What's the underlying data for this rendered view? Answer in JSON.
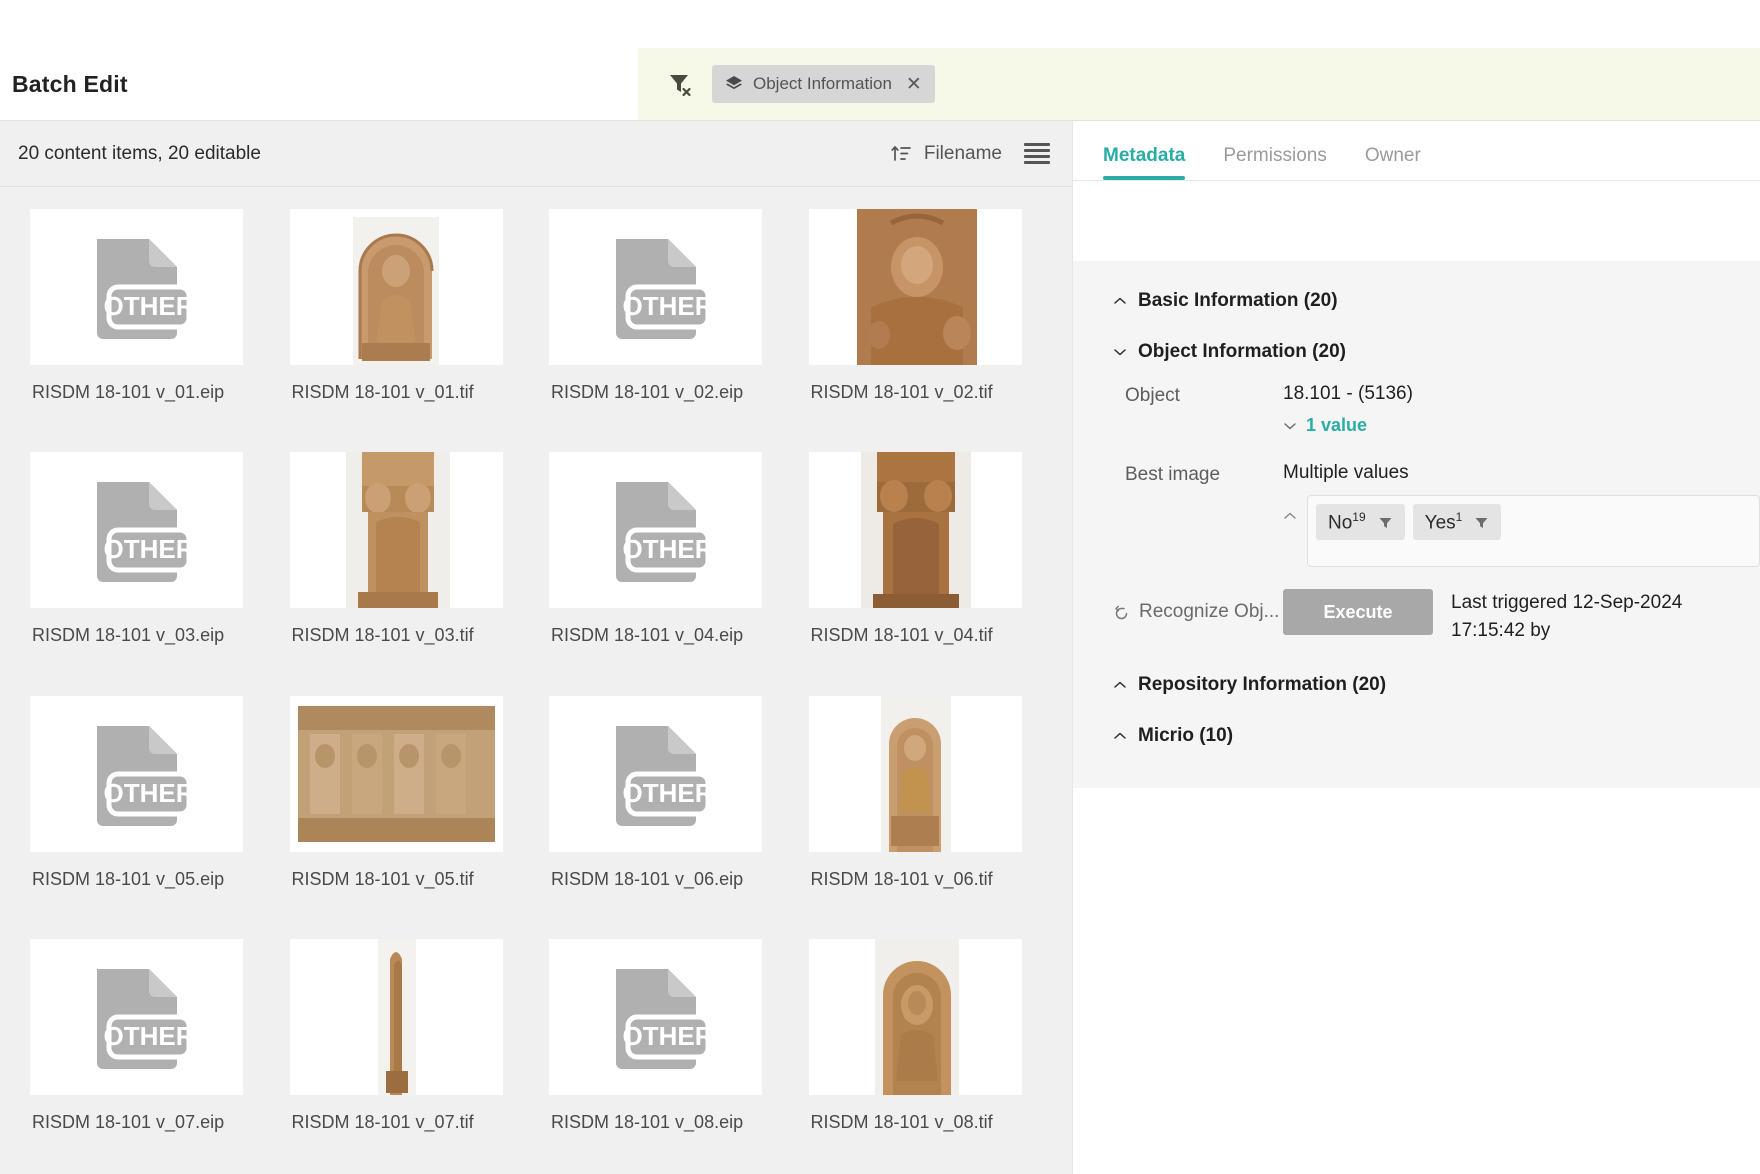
{
  "header": {
    "title": "Batch Edit",
    "filter_clear_icon": "filter-clear-icon",
    "active_filter": {
      "icon": "layers-icon",
      "label": "Object Information",
      "close": "✕"
    }
  },
  "left_pane": {
    "items_count": "20 content items, 20 editable",
    "sort": {
      "icon": "sort-ascending-icon",
      "label": "Filename"
    },
    "view_toggle_icon": "list-view-icon",
    "items": [
      {
        "name": "RISDM 18-101 v_01.eip",
        "type": "other"
      },
      {
        "name": "RISDM 18-101 v_01.tif",
        "type": "photo",
        "variant": "stele-seated"
      },
      {
        "name": "RISDM 18-101 v_02.eip",
        "type": "other"
      },
      {
        "name": "RISDM 18-101 v_02.tif",
        "type": "photo",
        "variant": "relief-close"
      },
      {
        "name": "RISDM 18-101 v_03.eip",
        "type": "other"
      },
      {
        "name": "RISDM 18-101 v_03.tif",
        "type": "photo",
        "variant": "pillar-lions"
      },
      {
        "name": "RISDM 18-101 v_04.eip",
        "type": "other"
      },
      {
        "name": "RISDM 18-101 v_04.tif",
        "type": "photo",
        "variant": "pillar-lions-dark"
      },
      {
        "name": "RISDM 18-101 v_05.eip",
        "type": "other"
      },
      {
        "name": "RISDM 18-101 v_05.tif",
        "type": "photo",
        "variant": "base-frieze"
      },
      {
        "name": "RISDM 18-101 v_06.eip",
        "type": "other"
      },
      {
        "name": "RISDM 18-101 v_06.tif",
        "type": "photo",
        "variant": "stele-tall"
      },
      {
        "name": "RISDM 18-101 v_07.eip",
        "type": "other"
      },
      {
        "name": "RISDM 18-101 v_07.tif",
        "type": "photo",
        "variant": "edge-thin"
      },
      {
        "name": "RISDM 18-101 v_08.eip",
        "type": "other"
      },
      {
        "name": "RISDM 18-101 v_08.tif",
        "type": "photo",
        "variant": "stele-arched"
      }
    ],
    "placeholder_label": "OTHER"
  },
  "right_pane": {
    "tabs": [
      {
        "label": "Metadata",
        "active": true
      },
      {
        "label": "Permissions",
        "active": false
      },
      {
        "label": "Owner",
        "active": false
      }
    ],
    "sections": {
      "basic_information": {
        "title": "Basic Information (20)",
        "state": "collapsed"
      },
      "object_information": {
        "title": "Object Information (20)",
        "state": "expanded"
      },
      "repository_information": {
        "title": "Repository Information (20)",
        "state": "collapsed"
      },
      "micrio": {
        "title": "Micrio (10)",
        "state": "collapsed"
      }
    },
    "fields": {
      "object": {
        "label": "Object",
        "value": "18.101 - (5136)",
        "sub_value": "1 value"
      },
      "best_image": {
        "label": "Best image",
        "value": "Multiple values",
        "chips": [
          {
            "text": "No",
            "count": "19",
            "filter_icon": "filter-icon"
          },
          {
            "text": "Yes",
            "count": "1",
            "filter_icon": "filter-icon"
          }
        ]
      },
      "recognize_object": {
        "label": "Recognize Obj...",
        "reset_icon": "reset-icon",
        "button": "Execute",
        "trigger_info": "Last triggered 12-Sep-2024 17:15:42 by"
      }
    }
  },
  "colors": {
    "accent": "#2aada6",
    "filter_bar_bg": "#f6f8e8",
    "chip_bg": "#d6d6d6",
    "panel_bg": "#f5f5f5",
    "grid_bg": "#f0f0f0",
    "execute_btn": "#a8a8a8"
  }
}
